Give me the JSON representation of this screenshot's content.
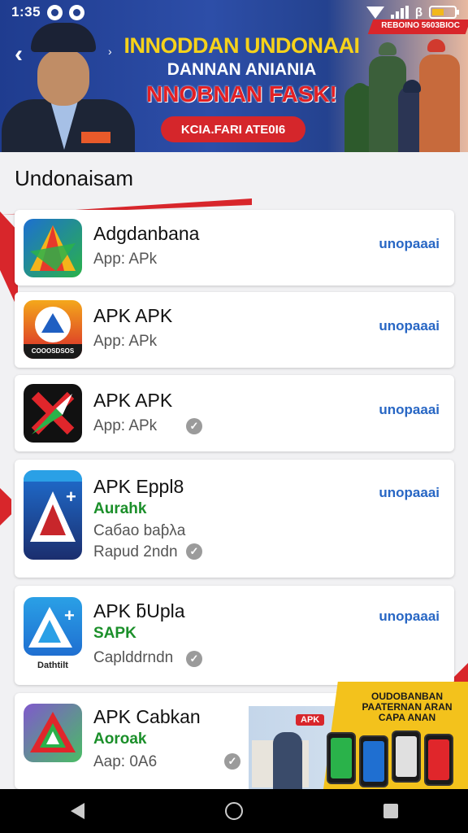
{
  "status_bar": {
    "time": "1:35"
  },
  "banner": {
    "headline_1": "INNODDAN UNDONAAI",
    "headline_2": "DANNAN ANIANIA",
    "headline_3": "NNOBNAN FASK!",
    "cta_label": "KCIA.FARI ATE0I6",
    "ribbon_label": "REBOINO 5603BIOC"
  },
  "section": {
    "title": "Undonaisam"
  },
  "apps": [
    {
      "name": "Adgdanbana",
      "line1": "App: APk",
      "action": "unopaaai"
    },
    {
      "name": "APK APK",
      "line1": "App: APk",
      "action": "unopaaai",
      "icon_caption": "COOOSDSOS"
    },
    {
      "name": "APK APK",
      "line1": "App: APk",
      "action": "unopaaai"
    },
    {
      "name": "APK Eppl8",
      "green": "Aurahk",
      "line1": "Caбao baƥλa",
      "line2": "Rapud 2ndn",
      "action": "unopaaai"
    },
    {
      "name": "APK ƃUpla",
      "green": "SAPK",
      "line1": "Caplddrndn",
      "action": "unopaaai",
      "icon_caption": "Dathtilt"
    },
    {
      "name": "APK Cabkan",
      "green": "Aoroak",
      "line1": "Aap: 0A6",
      "action": ""
    }
  ],
  "promo": {
    "badge": "APK",
    "text": "OUDOBANBAN PAATERNAN ARAN CAPA ANAN"
  },
  "colors": {
    "accent_red": "#d8262b",
    "link_blue": "#2766c4",
    "banner_blue": "#23408f",
    "headline_yellow": "#f6d21a"
  }
}
